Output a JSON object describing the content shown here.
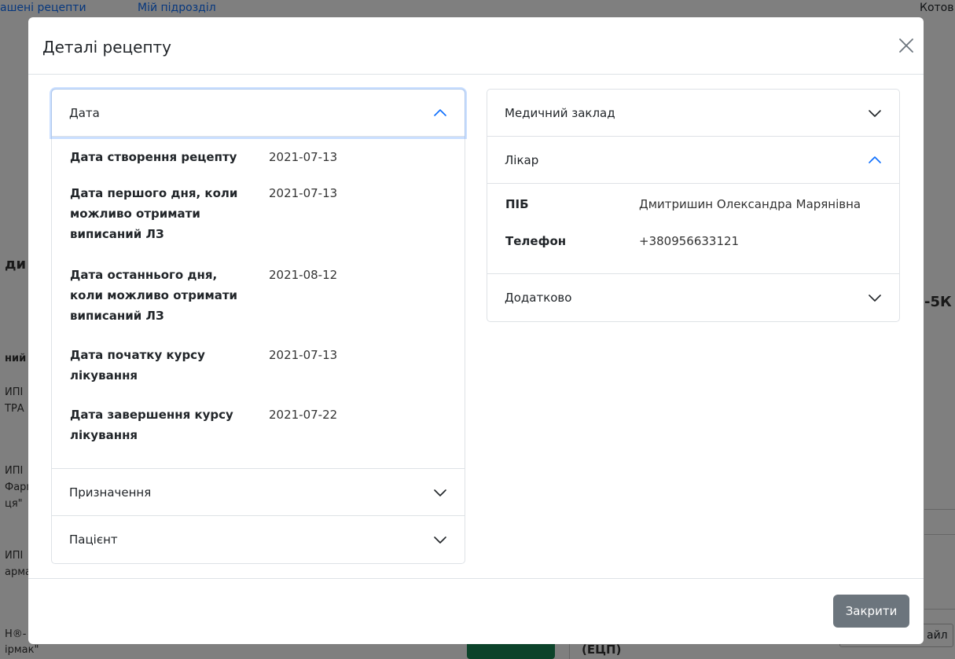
{
  "background": {
    "nav_left": "ашені рецепти",
    "nav_mid": "Мій підрозділ",
    "nav_right": "Котов",
    "frag_di": "ди",
    "frag_5k": "-5К",
    "frag_nii": "ний",
    "frag_ipi1": "ИПІ",
    "frag_tra": "ТРА",
    "frag_ipi2": "ИПІ",
    "frag_farm": "Фарм",
    "frag_ia": "ця\"",
    "frag_ipi3": "ИПІ",
    "frag_rma": "арма",
    "frag_n": "Н®-",
    "frag_rmak": "ірмак\"",
    "frag_ecp": "(ЕЦП)",
    "frag_file": "айл"
  },
  "modal": {
    "title": "Деталі рецепту",
    "close_button": "Закрити"
  },
  "left_accordion": {
    "date_header": "Дата",
    "rows": [
      {
        "label": "Дата створення рецепту",
        "value": "2021-07-13"
      },
      {
        "label": "Дата першого дня, коли можливо отримати виписаний ЛЗ",
        "value": "2021-07-13"
      },
      {
        "label": "Дата останнього дня, коли можливо отримати виписаний ЛЗ",
        "value": "2021-08-12"
      },
      {
        "label": "Дата початку курсу лікування",
        "value": "2021-07-13"
      },
      {
        "label": "Дата завершення курсу лікування",
        "value": "2021-07-22"
      }
    ],
    "prescription_header": "Призначення",
    "patient_header": "Пацієнт"
  },
  "right_accordion": {
    "facility_header": "Медичний заклад",
    "doctor_header": "Лікар",
    "doctor_rows": [
      {
        "label": "ПІБ",
        "value": "Дмитришин Олександра Марянівна"
      },
      {
        "label": "Телефон",
        "value": "+380956633121"
      }
    ],
    "extra_header": "Додатково"
  },
  "colors": {
    "accent": "#0d6efd",
    "secondary_button": "#6c757d"
  },
  "icons": {
    "close": "close-icon",
    "chevron_up": "chevron-up-icon",
    "chevron_down": "chevron-down-icon"
  }
}
